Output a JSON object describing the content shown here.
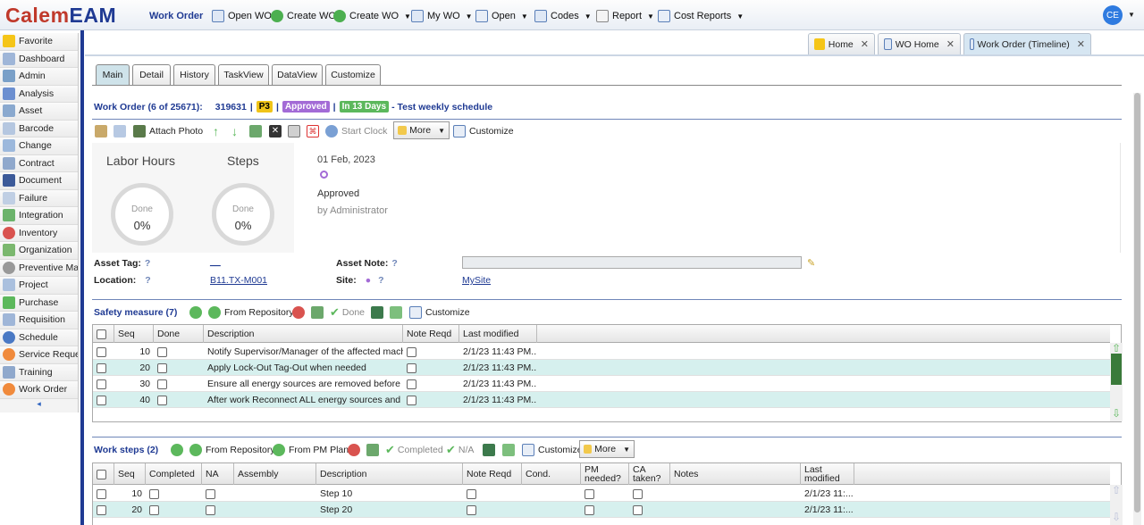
{
  "app": {
    "logo_part1": "Calem",
    "logo_part2": "EAM",
    "module": "Work Order",
    "user_initials": "CE"
  },
  "colors": {
    "brand_red": "#c0392b",
    "brand_blue": "#1f3a93",
    "approved": "#a36bd6",
    "in_days": "#5cb85c",
    "priority": "#f0c419",
    "row_alt": "#d6f0ee"
  },
  "toolbar": [
    {
      "label": "Open WO",
      "icon": "document-icon",
      "dd": false
    },
    {
      "label": "Create WO",
      "icon": "plus-circle-icon",
      "dd": false
    },
    {
      "label": "Create WO",
      "icon": "plus-circle-icon",
      "dd": true
    },
    {
      "label": "My WO",
      "icon": "document-icon",
      "dd": true
    },
    {
      "label": "Open",
      "icon": "open-icon",
      "dd": true
    },
    {
      "label": "Codes",
      "icon": "document-icon",
      "dd": true
    },
    {
      "label": "Report",
      "icon": "report-icon",
      "dd": true
    },
    {
      "label": "Cost Reports",
      "icon": "cost-report-icon",
      "dd": true
    }
  ],
  "sidebar": {
    "items": [
      "Favorite",
      "Dashboard",
      "Admin",
      "Analysis",
      "Asset",
      "Barcode",
      "Change",
      "Contract",
      "Document",
      "Failure",
      "Integration",
      "Inventory",
      "Organization",
      "Preventive Main",
      "Project",
      "Purchase",
      "Requisition",
      "Schedule",
      "Service Request",
      "Training",
      "Work Order"
    ],
    "collapse": "◂"
  },
  "window_tabs": [
    {
      "label": "Home",
      "icon": "star-icon"
    },
    {
      "label": "WO Home",
      "icon": "document-icon"
    },
    {
      "label": "Work Order (Timeline)",
      "icon": "document-icon"
    }
  ],
  "form_tabs": [
    "Main",
    "Detail",
    "History",
    "TaskView",
    "DataView",
    "Customize"
  ],
  "wo": {
    "count": "Work Order (6 of 25671):",
    "number": "319631",
    "priority": "P3",
    "status": "Approved",
    "due": "In 13 Days",
    "desc": "- Test weekly schedule"
  },
  "actions": {
    "attach": "Attach Photo",
    "start_clock": "Start Clock",
    "more": "More",
    "customize": "Customize"
  },
  "dashboard": {
    "labor_label": "Labor Hours",
    "steps_label": "Steps",
    "done": "Done",
    "labor_pct": "0%",
    "steps_pct": "0%"
  },
  "timeline": {
    "date": "01 Feb, 2023",
    "status": "Approved",
    "by": "by Administrator"
  },
  "fields": {
    "asset_tag_label": "Asset Tag:",
    "asset_tag_value": "__",
    "location_label": "Location:",
    "location_value": "B11.TX-M001",
    "asset_note_label": "Asset Note:",
    "site_label": "Site:",
    "site_value": "MySite",
    "help": "?"
  },
  "safety": {
    "title": "Safety measure (7)",
    "actions": {
      "from_repo": "From Repository",
      "done": "Done",
      "customize": "Customize"
    },
    "columns": [
      "Seq",
      "Done",
      "Description",
      "Note Reqd",
      "Last modified"
    ],
    "rows": [
      {
        "seq": "10",
        "desc": "Notify Supervisor/Manager of the affected machin...",
        "modified": "2/1/23 11:43 PM..."
      },
      {
        "seq": "20",
        "desc": "Apply Lock-Out Tag-Out when needed",
        "modified": "2/1/23 11:43 PM..."
      },
      {
        "seq": "30",
        "desc": "Ensure all energy sources are removed before sta...",
        "modified": "2/1/23 11:43 PM..."
      },
      {
        "seq": "40",
        "desc": "After work Reconnect ALL energy sources and ch...",
        "modified": "2/1/23 11:43 PM..."
      }
    ]
  },
  "steps": {
    "title": "Work steps (2)",
    "actions": {
      "from_repo": "From Repository",
      "from_pm": "From PM Plan",
      "completed": "Completed",
      "na": "N/A",
      "customize": "Customize",
      "more": "More"
    },
    "columns": [
      "Seq",
      "Completed",
      "NA",
      "Assembly",
      "Description",
      "Note Reqd",
      "Cond.",
      "PM needed?",
      "CA taken?",
      "Notes",
      "Last modified"
    ],
    "rows": [
      {
        "seq": "10",
        "desc": "Step 10",
        "modified": "2/1/23 11:..."
      },
      {
        "seq": "20",
        "desc": "Step 20",
        "modified": "2/1/23 11:..."
      }
    ]
  }
}
